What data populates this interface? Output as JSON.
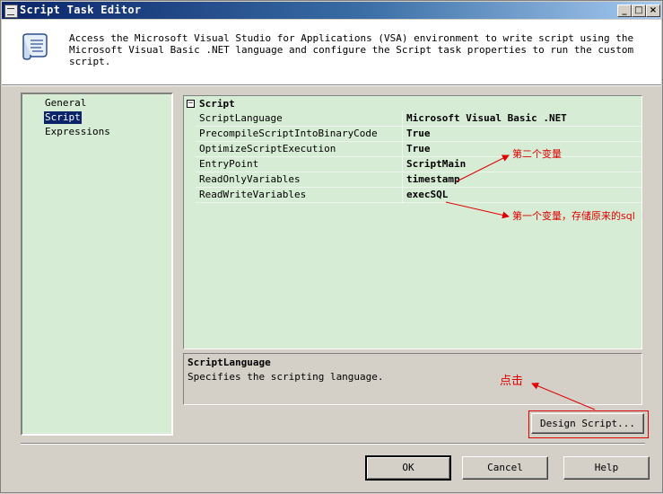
{
  "window": {
    "title": "Script Task Editor"
  },
  "header": {
    "description": "Access the Microsoft Visual Studio for Applications (VSA) environment to write script using the Microsoft Visual Basic .NET language and configure the Script task properties to run the custom script."
  },
  "nav": {
    "items": [
      {
        "label": "General",
        "selected": false
      },
      {
        "label": "Script",
        "selected": true
      },
      {
        "label": "Expressions",
        "selected": false
      }
    ]
  },
  "grid": {
    "category": "Script",
    "rows": [
      {
        "name": "ScriptLanguage",
        "value": "Microsoft Visual Basic .NET"
      },
      {
        "name": "PrecompileScriptIntoBinaryCode",
        "value": "True"
      },
      {
        "name": "OptimizeScriptExecution",
        "value": "True"
      },
      {
        "name": "EntryPoint",
        "value": "ScriptMain"
      },
      {
        "name": "ReadOnlyVariables",
        "value": "timestamp"
      },
      {
        "name": "ReadWriteVariables",
        "value": "execSQL"
      }
    ]
  },
  "description_panel": {
    "title": "ScriptLanguage",
    "text": "Specifies the scripting language."
  },
  "buttons": {
    "design_script": "Design Script...",
    "ok": "OK",
    "cancel": "Cancel",
    "help": "Help"
  },
  "annotations": {
    "second_variable": "第二个变量",
    "first_variable": "第一个变量，存储原来的sql",
    "click": "点击",
    "color": "#e00000"
  }
}
